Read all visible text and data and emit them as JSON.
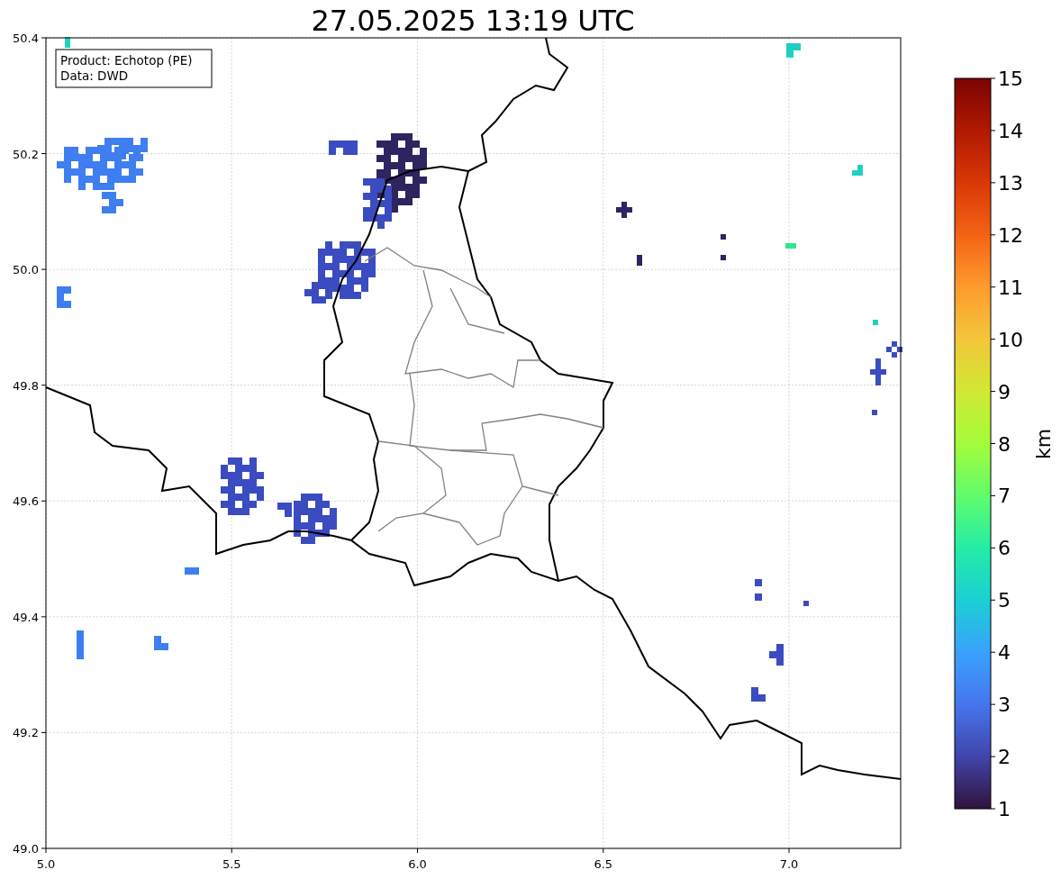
{
  "title": "27.05.2025 13:19 UTC",
  "info_box": {
    "lines": [
      "Product: Echotop (PE)",
      "Data: DWD"
    ]
  },
  "x_axis": {
    "ticks": [
      "5.0",
      "5.5",
      "6.0",
      "6.5",
      "7.0"
    ]
  },
  "y_axis": {
    "ticks": [
      "50.4",
      "50.2",
      "50.0",
      "49.8",
      "49.6",
      "49.4",
      "49.2",
      "49.0"
    ]
  },
  "colorbar": {
    "label": "km",
    "ticks": [
      "15",
      "14",
      "13",
      "12",
      "11",
      "10",
      "9",
      "8",
      "7",
      "6",
      "5",
      "4",
      "3",
      "2",
      "1"
    ]
  }
}
